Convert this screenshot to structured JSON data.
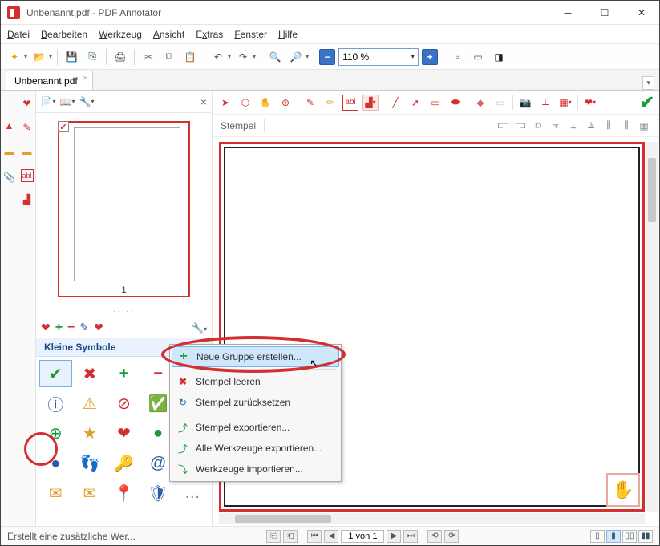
{
  "window": {
    "title": "Unbenannt.pdf - PDF Annotator"
  },
  "menu": {
    "datei": "Datei",
    "bearbeiten": "Bearbeiten",
    "werkzeug": "Werkzeug",
    "ansicht": "Ansicht",
    "extras": "Extras",
    "fenster": "Fenster",
    "hilfe": "Hilfe"
  },
  "toolbar": {
    "zoom_value": "110 %"
  },
  "tab": {
    "name": "Unbenannt.pdf"
  },
  "thumb": {
    "page_number": "1"
  },
  "stamps": {
    "section_title": "Kleine Symbole",
    "tool_label": "Stempel"
  },
  "context_menu": {
    "new_group": "Neue Gruppe erstellen...",
    "clear": "Stempel leeren",
    "reset": "Stempel zurücksetzen",
    "export": "Stempel exportieren...",
    "export_all": "Alle Werkzeuge exportieren...",
    "import": "Werkzeuge importieren..."
  },
  "status": {
    "msg": "Erstellt eine zusätzliche Wer...",
    "page_of": "1 von 1"
  }
}
